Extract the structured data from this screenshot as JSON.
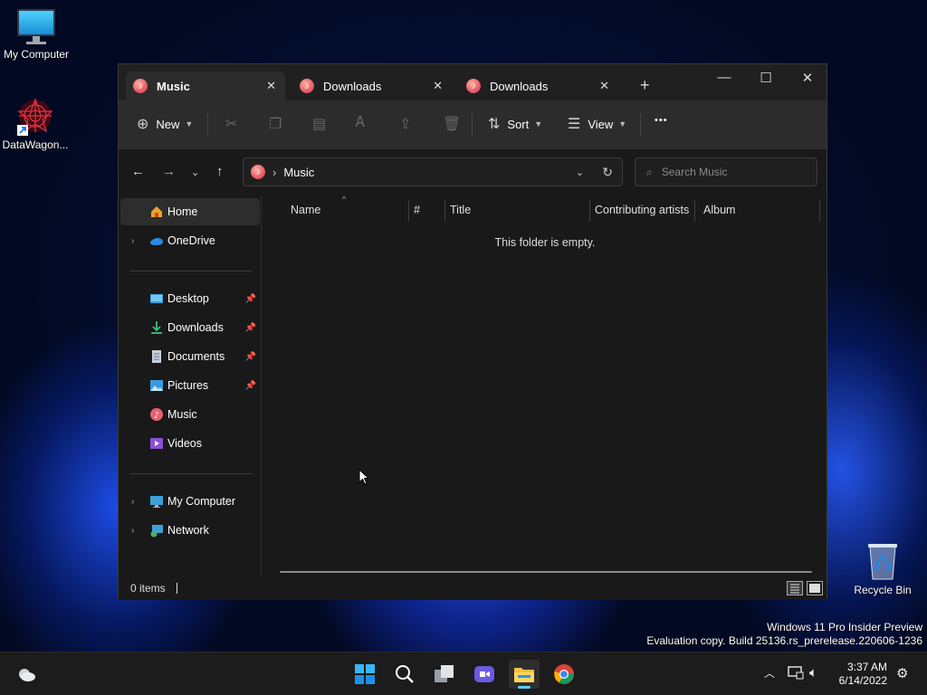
{
  "desktop": {
    "icons": [
      {
        "label": "My Computer",
        "icon": "monitor-icon"
      },
      {
        "label": "DataWagon...",
        "icon": "datawagon-app-icon"
      },
      {
        "label": "Recycle Bin",
        "icon": "recycle-bin-icon"
      }
    ],
    "watermark": {
      "line1": "Windows 11 Pro Insider Preview",
      "line2": "Evaluation copy. Build 25136.rs_prerelease.220606-1236"
    }
  },
  "explorer": {
    "tabs": [
      {
        "label": "Music",
        "icon": "music-icon",
        "active": true
      },
      {
        "label": "Downloads",
        "icon": "music-icon",
        "active": false
      },
      {
        "label": "Downloads",
        "icon": "music-icon",
        "active": false
      }
    ],
    "new_tab": "+",
    "window_controls": {
      "minimize": "—",
      "maximize": "☐",
      "close": "✕"
    },
    "toolbar": {
      "new_label": "New",
      "sort_label": "Sort",
      "view_label": "View",
      "more_label": "•••"
    },
    "address": {
      "separator": "›",
      "path": "Music"
    },
    "search": {
      "placeholder": "Search Music"
    },
    "sidebar": {
      "items": [
        {
          "label": "Home",
          "icon": "home-icon",
          "active": true
        },
        {
          "label": "OneDrive",
          "icon": "cloud-icon",
          "expandable": true
        },
        {
          "label": "Desktop",
          "icon": "desktop-icon",
          "pinned": true
        },
        {
          "label": "Downloads",
          "icon": "download-icon",
          "pinned": true
        },
        {
          "label": "Documents",
          "icon": "document-icon",
          "pinned": true
        },
        {
          "label": "Pictures",
          "icon": "pictures-icon",
          "pinned": true
        },
        {
          "label": "Music",
          "icon": "music-icon"
        },
        {
          "label": "Videos",
          "icon": "video-icon"
        },
        {
          "label": "My Computer",
          "icon": "monitor-icon",
          "expandable": true
        },
        {
          "label": "Network",
          "icon": "network-icon",
          "expandable": true
        }
      ]
    },
    "columns": [
      "Name",
      "#",
      "Title",
      "Contributing artists",
      "Album"
    ],
    "empty_message": "This folder is empty.",
    "status": {
      "items": "0 items"
    }
  },
  "taskbar": {
    "apps": [
      "start-icon",
      "search-icon",
      "task-view-icon",
      "chat-icon",
      "file-explorer-icon",
      "chrome-icon"
    ],
    "clock": {
      "time": "3:37 AM",
      "date": "6/14/2022"
    }
  },
  "colors": {
    "accent": "#60cdff",
    "window_bg": "#191919",
    "toolbar_bg": "#2c2c2c"
  }
}
